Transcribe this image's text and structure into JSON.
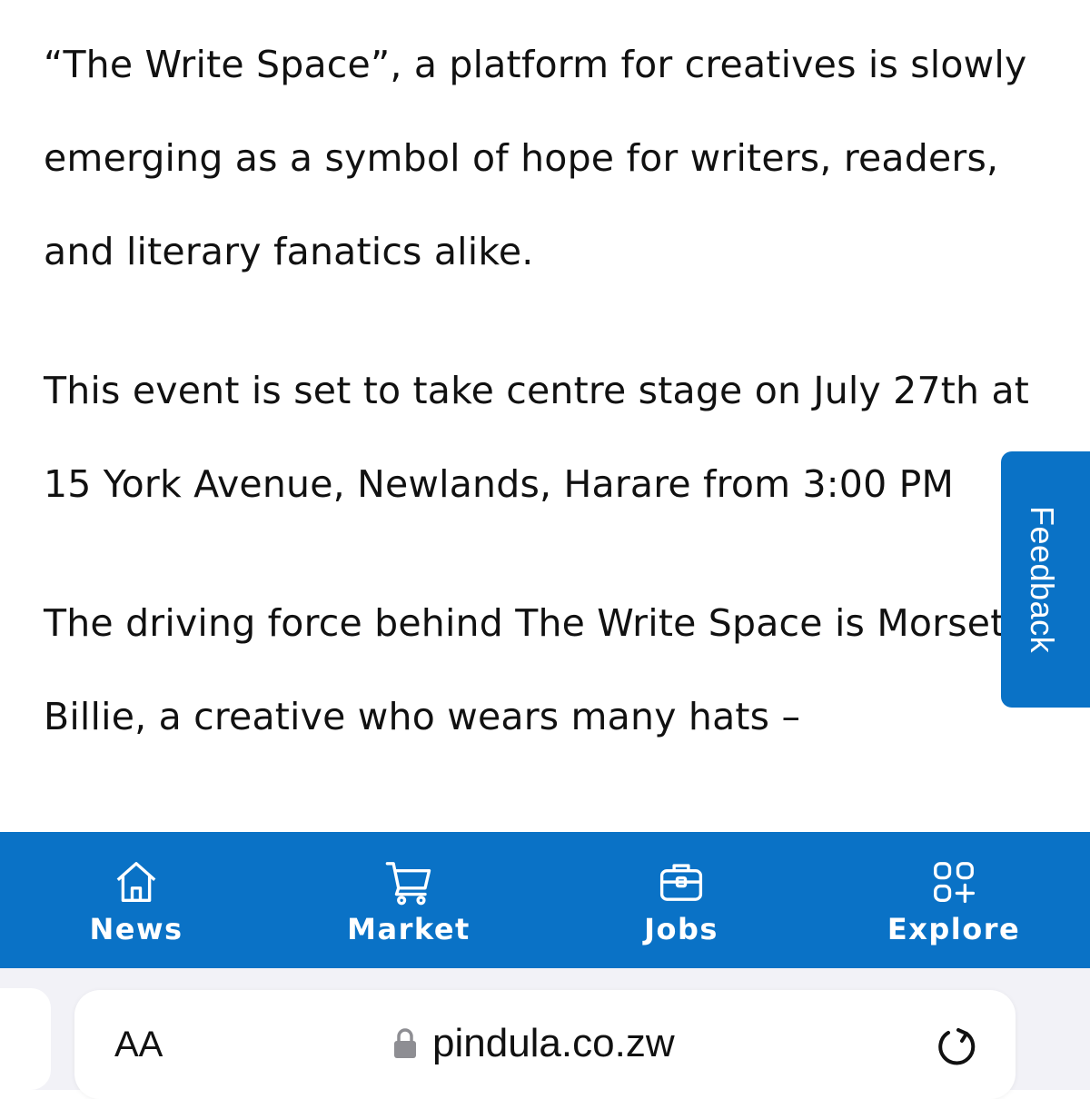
{
  "article": {
    "paragraphs": [
      "“The Write Space”, a platform for creatives is slowly emerging as a symbol of hope for writers, readers, and literary fanatics alike.",
      "This event is set to take centre stage on July 27th at 15 York Avenue, Newlands, Harare from 3:00 PM",
      "The driving force behind The Write Space is Morset Billie, a creative who wears many hats –"
    ]
  },
  "feedback": {
    "label": "Feedback"
  },
  "nav": {
    "items": [
      {
        "label": "News",
        "icon": "home-icon"
      },
      {
        "label": "Market",
        "icon": "cart-icon"
      },
      {
        "label": "Jobs",
        "icon": "briefcase-icon"
      },
      {
        "label": "Explore",
        "icon": "explore-grid-icon"
      }
    ]
  },
  "browser": {
    "text_size_button": "AA",
    "url": "pindula.co.zw"
  },
  "colors": {
    "brand_blue": "#0a72c6",
    "browser_bar": "#f2f2f7"
  }
}
